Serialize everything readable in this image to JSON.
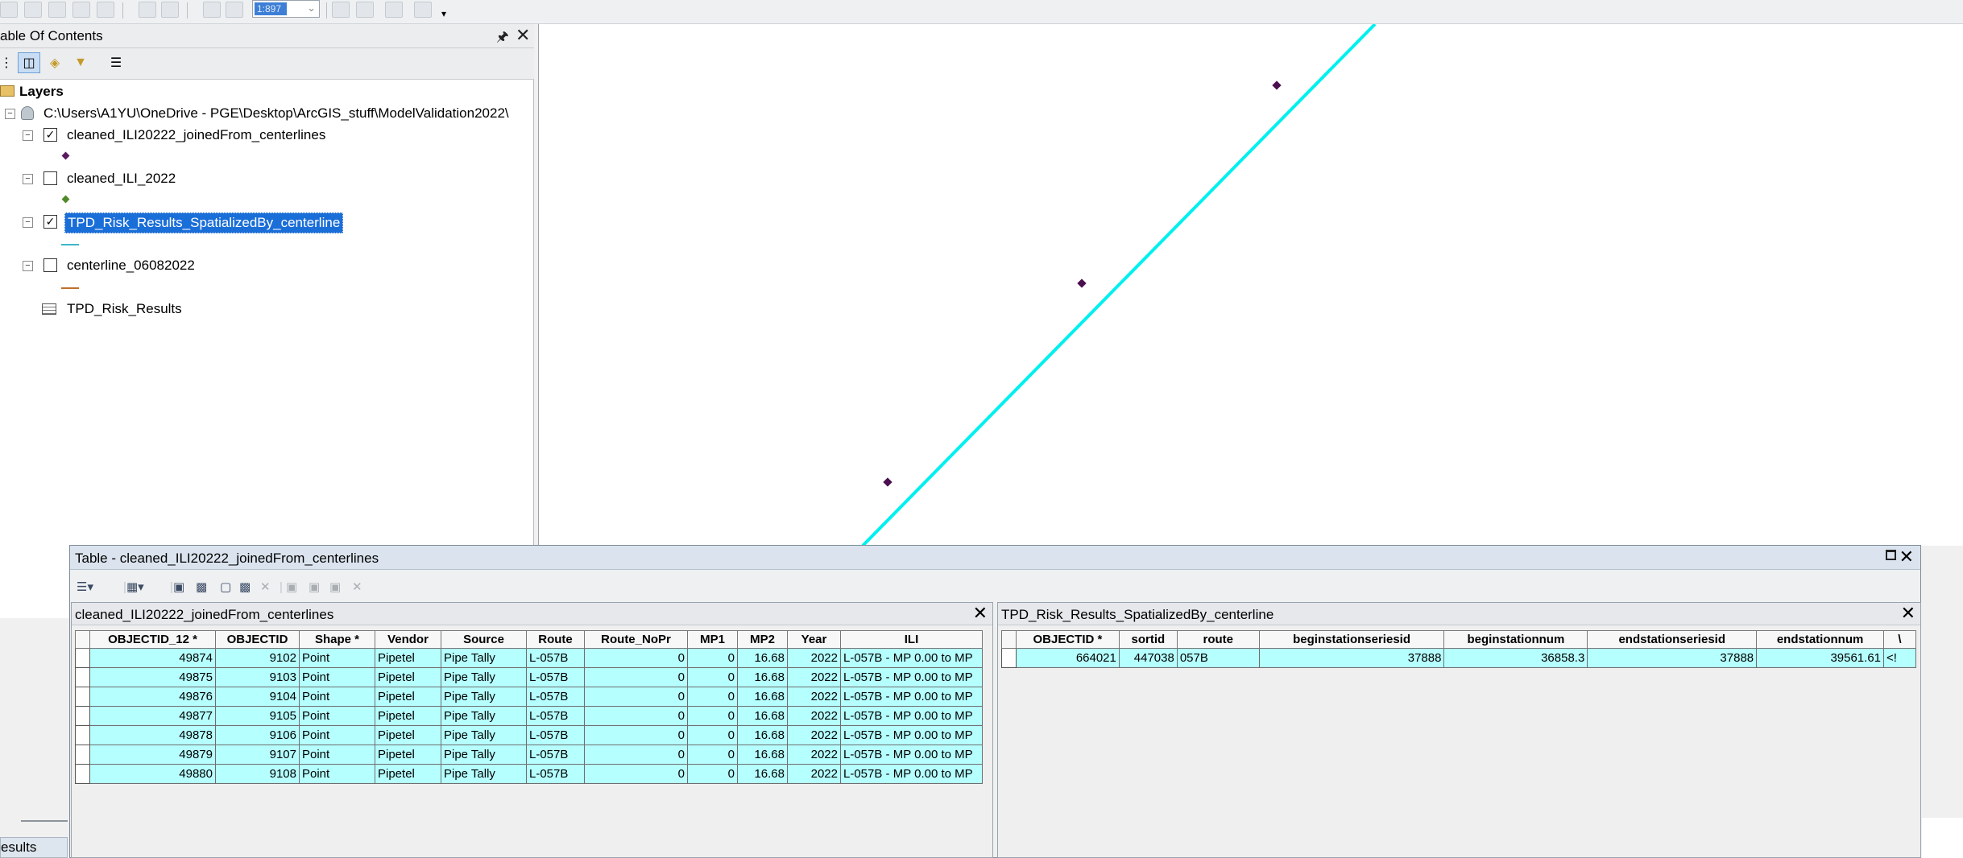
{
  "toc": {
    "title": "able Of Contents",
    "pin_icon": "pin-icon",
    "root_label": "Layers",
    "source_path": "C:\\Users\\A1YU\\OneDrive - PGE\\Desktop\\ArcGIS_stuff\\ModelValidation2022\\",
    "layers": [
      {
        "name": "cleaned_ILI20222_joinedFrom_centerlines",
        "checked": true,
        "symbol": "point",
        "color": "#5c1a5e"
      },
      {
        "name": "cleaned_ILI_2022",
        "checked": false,
        "symbol": "point",
        "color": "#4f8a2a"
      },
      {
        "name": "TPD_Risk_Results_SpatializedBy_centerline",
        "checked": true,
        "symbol": "line",
        "color": "#3cb8c8",
        "selected": true
      },
      {
        "name": "centerline_06082022",
        "checked": false,
        "symbol": "line",
        "color": "#c0702c"
      }
    ],
    "standalone_table": "TPD_Risk_Results"
  },
  "toolbar": {
    "scale_value": "1:897"
  },
  "map": {
    "line_color": "#00f0f0",
    "point_color": "#4b0f4f"
  },
  "table_window": {
    "title": "Table - cleaned_ILI20222_joinedFrom_centerlines",
    "left_table": {
      "name": "cleaned_ILI20222_joinedFrom_centerlines",
      "columns": [
        "OBJECTID_12 *",
        "OBJECTID",
        "Shape *",
        "Vendor",
        "Source",
        "Route",
        "Route_NoPr",
        "MP1",
        "MP2",
        "Year",
        "ILI"
      ],
      "rows": [
        [
          "49874",
          "9102",
          "Point",
          "Pipetel",
          "Pipe Tally",
          "L-057B",
          "0",
          "0",
          "16.68",
          "2022",
          "L-057B - MP 0.00 to MP"
        ],
        [
          "49875",
          "9103",
          "Point",
          "Pipetel",
          "Pipe Tally",
          "L-057B",
          "0",
          "0",
          "16.68",
          "2022",
          "L-057B - MP 0.00 to MP"
        ],
        [
          "49876",
          "9104",
          "Point",
          "Pipetel",
          "Pipe Tally",
          "L-057B",
          "0",
          "0",
          "16.68",
          "2022",
          "L-057B - MP 0.00 to MP"
        ],
        [
          "49877",
          "9105",
          "Point",
          "Pipetel",
          "Pipe Tally",
          "L-057B",
          "0",
          "0",
          "16.68",
          "2022",
          "L-057B - MP 0.00 to MP"
        ],
        [
          "49878",
          "9106",
          "Point",
          "Pipetel",
          "Pipe Tally",
          "L-057B",
          "0",
          "0",
          "16.68",
          "2022",
          "L-057B - MP 0.00 to MP"
        ],
        [
          "49879",
          "9107",
          "Point",
          "Pipetel",
          "Pipe Tally",
          "L-057B",
          "0",
          "0",
          "16.68",
          "2022",
          "L-057B - MP 0.00 to MP"
        ],
        [
          "49880",
          "9108",
          "Point",
          "Pipetel",
          "Pipe Tally",
          "L-057B",
          "0",
          "0",
          "16.68",
          "2022",
          "L-057B - MP 0.00 to MP"
        ]
      ]
    },
    "right_table": {
      "name": "TPD_Risk_Results_SpatializedBy_centerline",
      "columns": [
        "OBJECTID *",
        "sortid",
        "route",
        "beginstationseriesid",
        "beginstationnum",
        "endstationseriesid",
        "endstationnum",
        "\\"
      ],
      "rows": [
        [
          "664021",
          "447038",
          "057B",
          "37888",
          "36858.3",
          "37888",
          "39561.61",
          "<!"
        ]
      ]
    }
  },
  "leftover": {
    "results_tab": "esults"
  }
}
